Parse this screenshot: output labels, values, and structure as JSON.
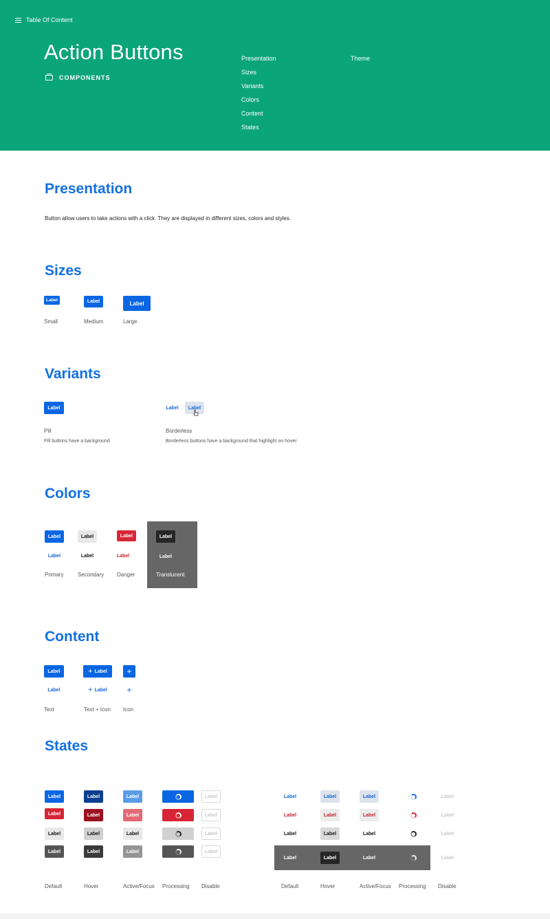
{
  "header": {
    "toc_label": "Table Of Content",
    "title": "Action Buttons",
    "category": "COMPONENTS",
    "background": "#0ba57a",
    "toc_links": [
      "Presentation",
      "Sizes",
      "Variants",
      "Colors",
      "Content",
      "States"
    ],
    "toc_links_col2": [
      "Theme"
    ]
  },
  "accent": "#1270e0",
  "button_label": "Label",
  "presentation": {
    "title": "Presentation",
    "text": "Button allow users to take actions with a click. They are displayed in different sizes, colors and styles."
  },
  "sizes": {
    "title": "Sizes",
    "captions": [
      "Small",
      "Medium",
      "Large"
    ]
  },
  "variants": {
    "title": "Variants",
    "pill": {
      "name": "Pill",
      "description": "Pill buttons have a background"
    },
    "borderless": {
      "name": "Borderless",
      "description": "Borderless buttons have a background that highlight on hover"
    }
  },
  "colors": {
    "title": "Colors",
    "captions": [
      "Primary",
      "Secondary",
      "Danger",
      "Translucent"
    ],
    "palette": {
      "primary": "#0a66e3",
      "danger": "#d72535",
      "secondary": "#e8e8e8",
      "translucent_panel": "#666666"
    }
  },
  "content": {
    "title": "Content",
    "captions": [
      "Text",
      "Text + Icon",
      "Icon"
    ],
    "icon": "plus-icon"
  },
  "states": {
    "title": "States",
    "captions": [
      "Default",
      "Hover",
      "Active/Focus",
      "Processing",
      "Disable"
    ],
    "captions_borderless": [
      "Default",
      "Hover",
      "Active/Focus",
      "Processing",
      "Disable"
    ]
  }
}
